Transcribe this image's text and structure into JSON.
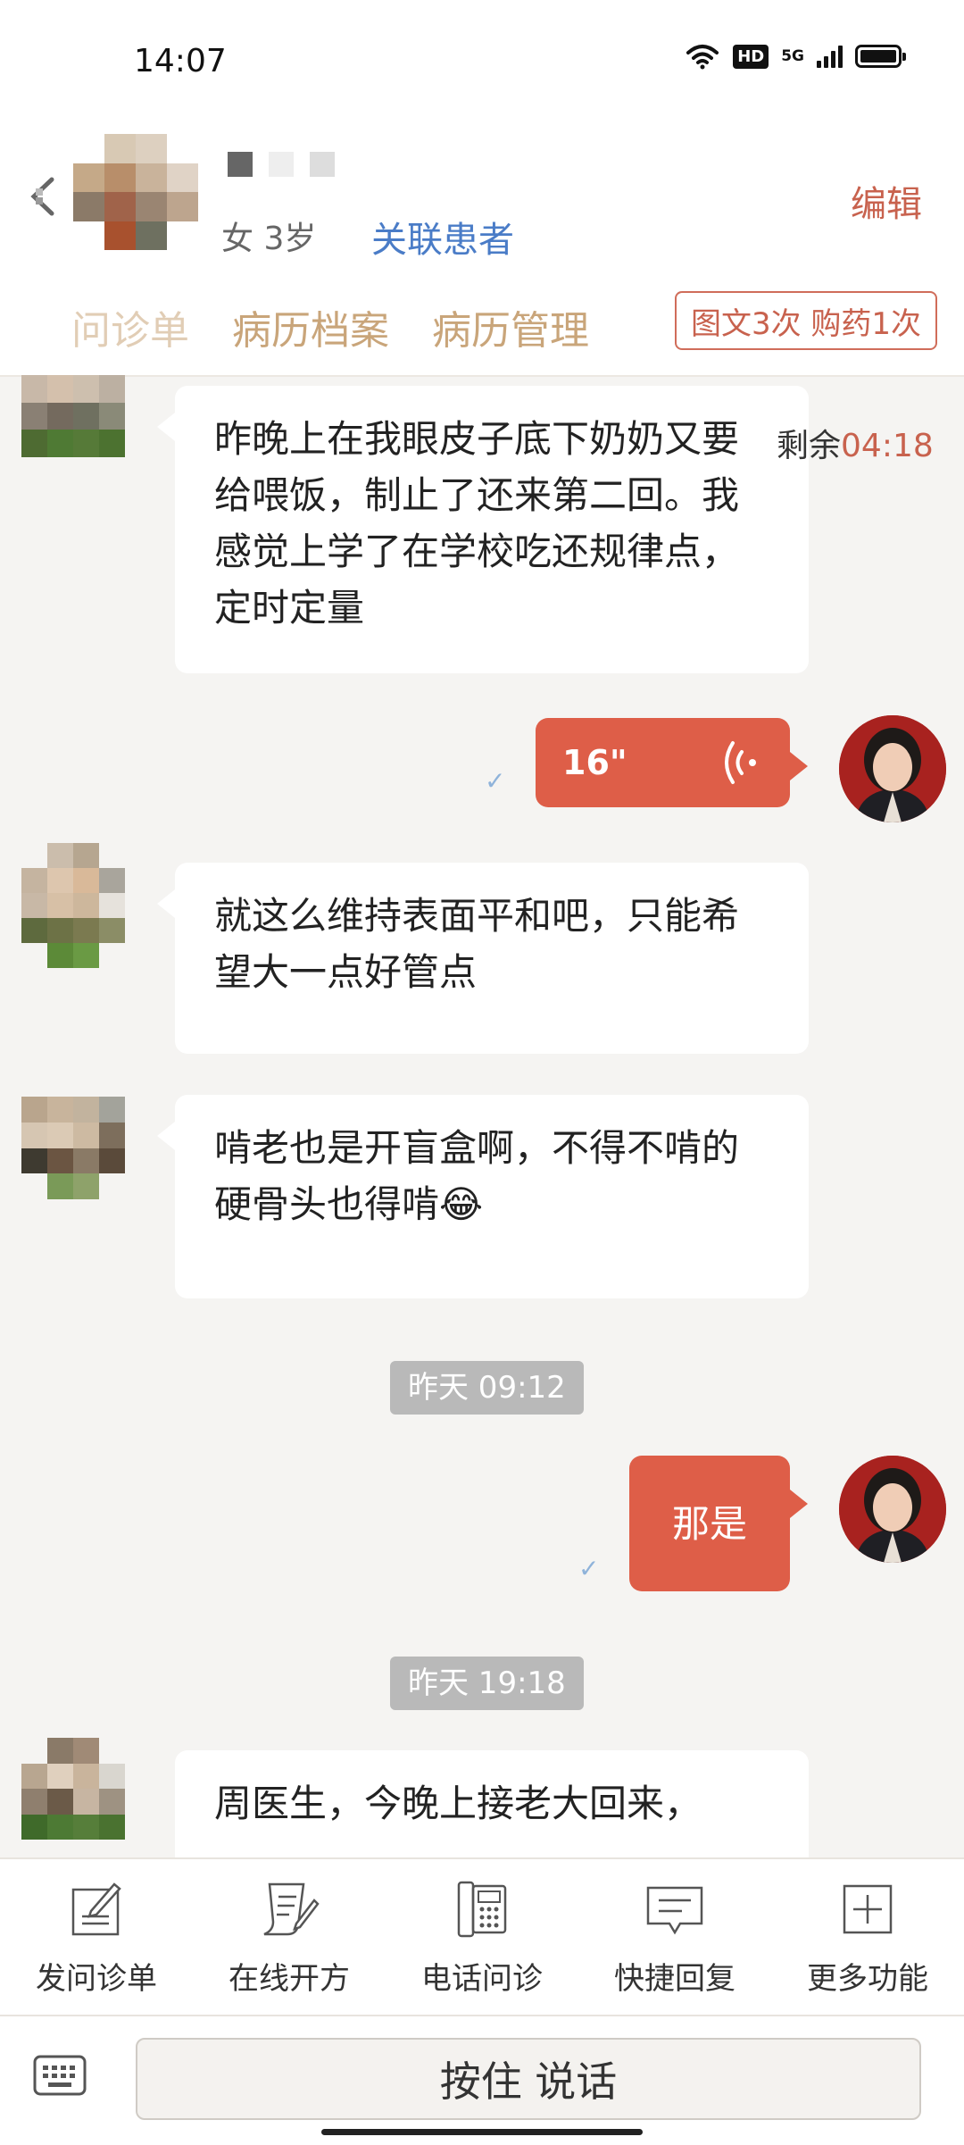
{
  "status_bar": {
    "time": "14:07",
    "hd": "HD",
    "network": "5G"
  },
  "header": {
    "patient_info": "女 3岁",
    "link_patient_label": "关联患者",
    "edit_label": "编辑",
    "tabs": [
      "问诊单",
      "病历档案",
      "病历管理"
    ],
    "quota_badge": "图文3次 购药1次"
  },
  "timer": {
    "label": "剩余",
    "value": "04:18"
  },
  "messages": [
    {
      "sender": "patient",
      "type": "text",
      "text": "昨晚上在我眼皮子底下奶奶又要给喂饭，制止了还来第二回。我感觉上学了在学校吃还规律点，定时定量"
    },
    {
      "sender": "doctor",
      "type": "voice",
      "duration": "16\""
    },
    {
      "sender": "patient",
      "type": "text",
      "text": "就这么维持表面平和吧，只能希望大一点好管点"
    },
    {
      "sender": "patient",
      "type": "text",
      "text": "啃老也是开盲盒啊，不得不啃的硬骨头也得啃😂"
    },
    {
      "type": "time",
      "text": "昨天 09:12"
    },
    {
      "sender": "doctor",
      "type": "text",
      "text": "那是"
    },
    {
      "type": "time",
      "text": "昨天 19:18"
    },
    {
      "sender": "patient",
      "type": "text",
      "text": "周医生，今晚上接老大回来，"
    }
  ],
  "toolbar": {
    "items": [
      {
        "label": "发问诊单",
        "icon": "form-pen-icon"
      },
      {
        "label": "在线开方",
        "icon": "prescription-icon"
      },
      {
        "label": "电话问诊",
        "icon": "phone-icon"
      },
      {
        "label": "快捷回复",
        "icon": "quick-reply-icon"
      },
      {
        "label": "更多功能",
        "icon": "plus-box-icon"
      }
    ]
  },
  "input": {
    "talk_label": "按住 说话"
  },
  "colors": {
    "accent": "#de5e48",
    "link": "#4a7cc7",
    "tab": "#c9a57a",
    "background": "#f5f4f2"
  }
}
